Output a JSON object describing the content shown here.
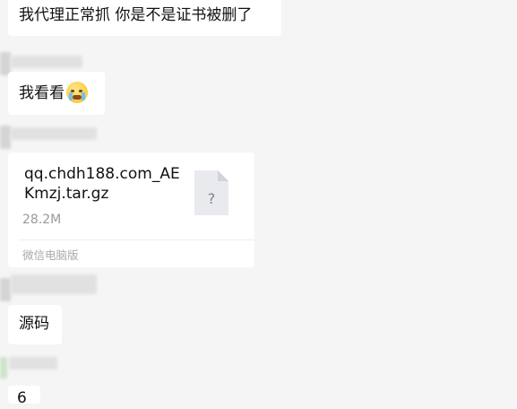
{
  "messages": [
    {
      "text": "我代理正常抓  你是不是证书被删了"
    },
    {
      "text": "我看看",
      "emoji": "crying-face-icon"
    },
    {
      "type": "file",
      "file_name": "qq.chdh188.com_AEKmzj.tar.gz",
      "file_size": "28.2M",
      "source": "微信电脑版",
      "file_icon_glyph": "?"
    },
    {
      "text": "源码"
    },
    {
      "text": "6"
    }
  ]
}
